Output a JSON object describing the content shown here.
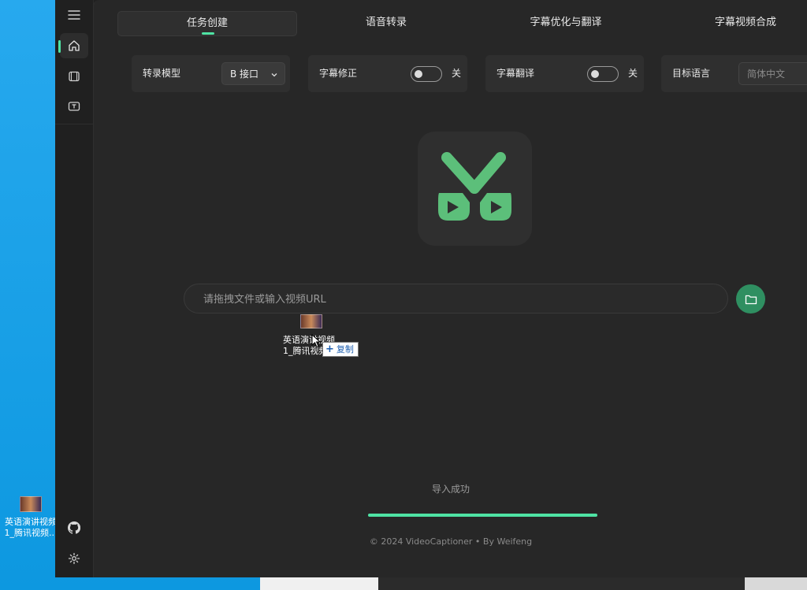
{
  "desktop": {
    "icon_line1": "英语演讲视频",
    "icon_line2": "1_腾讯视频..."
  },
  "sidebar": {
    "items": [
      {
        "name": "menu-icon"
      },
      {
        "name": "home-icon"
      },
      {
        "name": "film-icon"
      },
      {
        "name": "text-icon"
      },
      {
        "name": "github-icon"
      },
      {
        "name": "settings-icon"
      }
    ]
  },
  "tabs": [
    {
      "label": "任务创建",
      "active": true
    },
    {
      "label": "语音转录",
      "active": false
    },
    {
      "label": "字幕优化与翻译",
      "active": false
    },
    {
      "label": "字幕视频合成",
      "active": false
    }
  ],
  "options": {
    "model_label": "转录模型",
    "model_value": "B 接口",
    "correction_label": "字幕修正",
    "correction_state": "关",
    "translation_label": "字幕翻译",
    "translation_state": "关",
    "language_label": "目标语言",
    "language_value": "简体中文"
  },
  "search": {
    "placeholder": "请拖拽文件或输入视频URL"
  },
  "drag": {
    "line1": "英语演讲视频",
    "line2": "1_腾讯视频",
    "copy_label": "复制"
  },
  "footer": {
    "status": "导入成功",
    "progress": 1.0,
    "copyright": "© 2024 VideoCaptioner • By Weifeng"
  },
  "colors": {
    "accent": "#4fe3a4",
    "logo_green": "#5cbf7a",
    "folder_button": "#2f8f61"
  }
}
